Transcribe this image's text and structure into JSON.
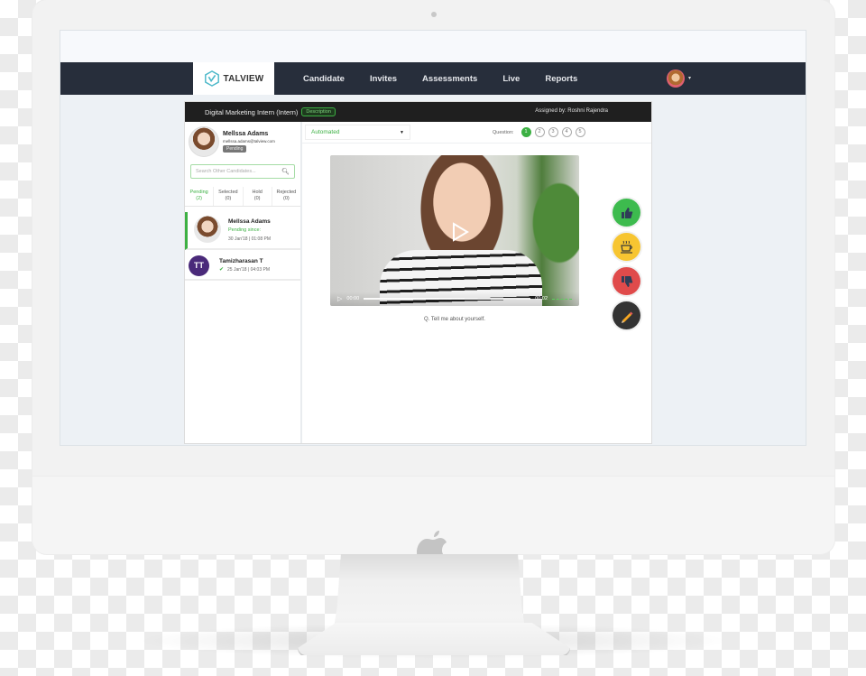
{
  "brand": {
    "name": "TALVIEW",
    "accent": "#3cb043",
    "nav_bg": "#272e3b"
  },
  "nav": {
    "items": [
      {
        "label": "Candidate"
      },
      {
        "label": "Invites"
      },
      {
        "label": "Assessments"
      },
      {
        "label": "Live"
      },
      {
        "label": "Reports"
      }
    ],
    "user_menu_caret": "▾"
  },
  "job": {
    "title": "Digital Marketing Intern (Intern)",
    "description_label": "Description",
    "assigned_by": "Assigned by: Roshni Rajendra"
  },
  "candidate": {
    "name": "Mellssa Adams",
    "email": "mellssa.adams@talview.com",
    "status": "Pending"
  },
  "search": {
    "placeholder": "Search Other Candidates..."
  },
  "status_tabs": [
    {
      "label": "Pending",
      "count": "(2)",
      "active": true
    },
    {
      "label": "Selected",
      "count": "(0)",
      "active": false
    },
    {
      "label": "Hold",
      "count": "(0)",
      "active": false
    },
    {
      "label": "Rejected",
      "count": "(0)",
      "active": false
    }
  ],
  "candidates": [
    {
      "name": "Mellssa Adams",
      "sub": "Pending since:",
      "date": "30 Jan'18 | 01:08 PM",
      "active": true
    },
    {
      "name": "Tamizharasan T",
      "initials": "TT",
      "date": "25 Jan'18 | 04:03 PM",
      "active": false
    }
  ],
  "mode": {
    "value": "Automated",
    "caret": "▼"
  },
  "questions": {
    "label": "Question:",
    "items": [
      "1",
      "2",
      "3",
      "4",
      "5"
    ],
    "active": "1"
  },
  "video": {
    "current_time": "00:00",
    "duration": "00:02",
    "progress": 0
  },
  "question_text": "Q. Tell me about yourself.",
  "actions": [
    {
      "name": "shortlist",
      "icon": "thumbs-up-icon",
      "color": "#3dbb4e"
    },
    {
      "name": "hold",
      "icon": "coffee-cup-icon",
      "color": "#f7c531"
    },
    {
      "name": "reject",
      "icon": "thumbs-down-icon",
      "color": "#e04b4b"
    },
    {
      "name": "notes",
      "icon": "pencil-icon",
      "color": "#333333"
    }
  ]
}
